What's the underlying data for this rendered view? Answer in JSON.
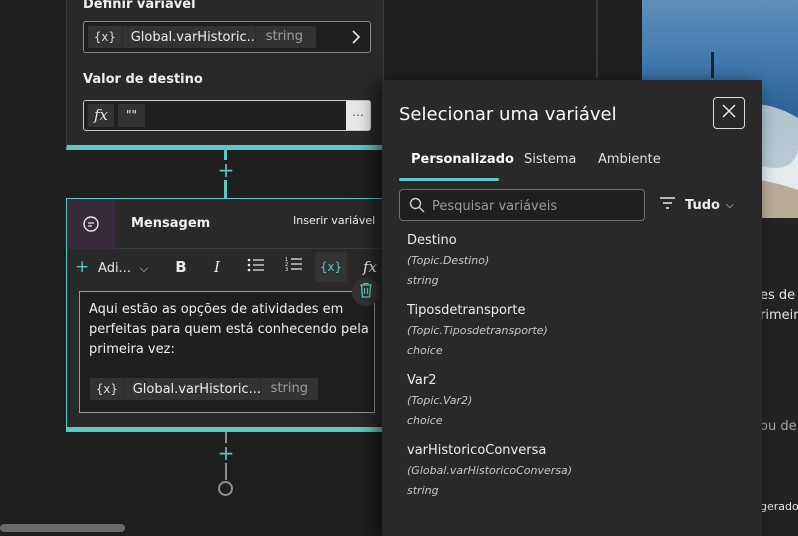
{
  "set_variable": {
    "label": "Definir variável",
    "variable_chip": {
      "icon": "{x}",
      "name": "Global.varHistoric...",
      "type": "string"
    },
    "target_label": "Valor de destino",
    "target_value": "\"\""
  },
  "message_node": {
    "title": "Mensagem",
    "tooltip": "Inserir variável",
    "toolbar": {
      "add_label": "Adi..."
    },
    "body_text": "Aqui estão as opções de atividades em perfeitas para quem está conhecendo pela primeira vez:",
    "variable_chip": {
      "icon": "{x}",
      "name": "Global.varHistoric...",
      "type": "string"
    }
  },
  "preview": {
    "line1": "es de",
    "line2": "rimeir",
    "line3": "ou de",
    "line4": "gerado"
  },
  "panel": {
    "title": "Selecionar uma variável",
    "tabs": [
      "Personalizado",
      "Sistema",
      "Ambiente"
    ],
    "active_tab": "Personalizado",
    "search_placeholder": "Pesquisar variáveis",
    "filter_label": "Tudo",
    "variables": [
      {
        "name": "Destino",
        "path": "(Topic.Destino)",
        "type": "string"
      },
      {
        "name": "Tiposdetransporte",
        "path": "(Topic.Tiposdetransporte)",
        "type": "choice"
      },
      {
        "name": "Var2",
        "path": "(Topic.Var2)",
        "type": "choice"
      },
      {
        "name": "varHistoricoConversa",
        "path": "(Global.varHistoricoConversa)",
        "type": "string"
      }
    ]
  },
  "colors": {
    "accent": "#5fc8c2",
    "background": "#1f1f1f",
    "panel": "#292929"
  }
}
